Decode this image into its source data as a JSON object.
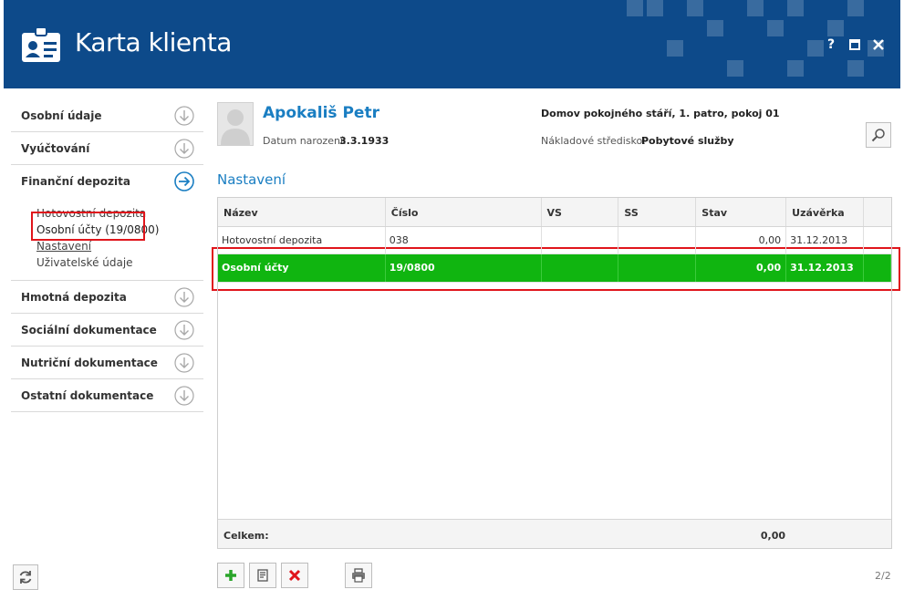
{
  "window": {
    "title": "Karta klienta",
    "controls": {
      "help": "?",
      "maximize": "□",
      "close": "✕"
    }
  },
  "sidebar": {
    "items": [
      {
        "label": "Osobní údaje",
        "state": "collapsed"
      },
      {
        "label": "Vyúčtování",
        "state": "collapsed"
      },
      {
        "label": "Finanční depozita",
        "state": "active"
      },
      {
        "label": "Hmotná depozita",
        "state": "collapsed"
      },
      {
        "label": "Sociální dokumentace",
        "state": "collapsed"
      },
      {
        "label": "Nutriční dokumentace",
        "state": "collapsed"
      },
      {
        "label": "Ostatní dokumentace",
        "state": "collapsed"
      }
    ],
    "subitems": [
      {
        "label": "Hotovostní depozita"
      },
      {
        "label": "Osobní účty (19/0800)"
      },
      {
        "label": "Nastavení"
      },
      {
        "label": "Uživatelské údaje"
      }
    ]
  },
  "client": {
    "name": "Apokališ Petr",
    "dob_label": "Datum narození:",
    "dob": "3.3.1933",
    "address": "Domov pokojného stáří, 1. patro, pokoj 01",
    "cost_center_label": "Nákladové středisko:",
    "cost_center": "Pobytové služby"
  },
  "section": {
    "title": "Nastavení"
  },
  "table": {
    "columns": [
      "Název",
      "Číslo",
      "VS",
      "SS",
      "Stav",
      "Uzávěrka"
    ],
    "rows": [
      {
        "nazev": "Hotovostní depozita",
        "cislo": "038",
        "vs": "",
        "ss": "",
        "stav": "0,00",
        "uzaverka": "31.12.2013",
        "selected": false
      },
      {
        "nazev": "Osobní účty",
        "cislo": "19/0800",
        "vs": "",
        "ss": "",
        "stav": "0,00",
        "uzaverka": "31.12.2013",
        "selected": true
      }
    ],
    "footer": {
      "label": "Celkem:",
      "total": "0,00"
    }
  },
  "pager": {
    "text": "2/2"
  },
  "colors": {
    "header": "#0d4a8a",
    "accent": "#1a7ec2",
    "selected_row": "#10b510",
    "highlight": "#e0151b"
  }
}
